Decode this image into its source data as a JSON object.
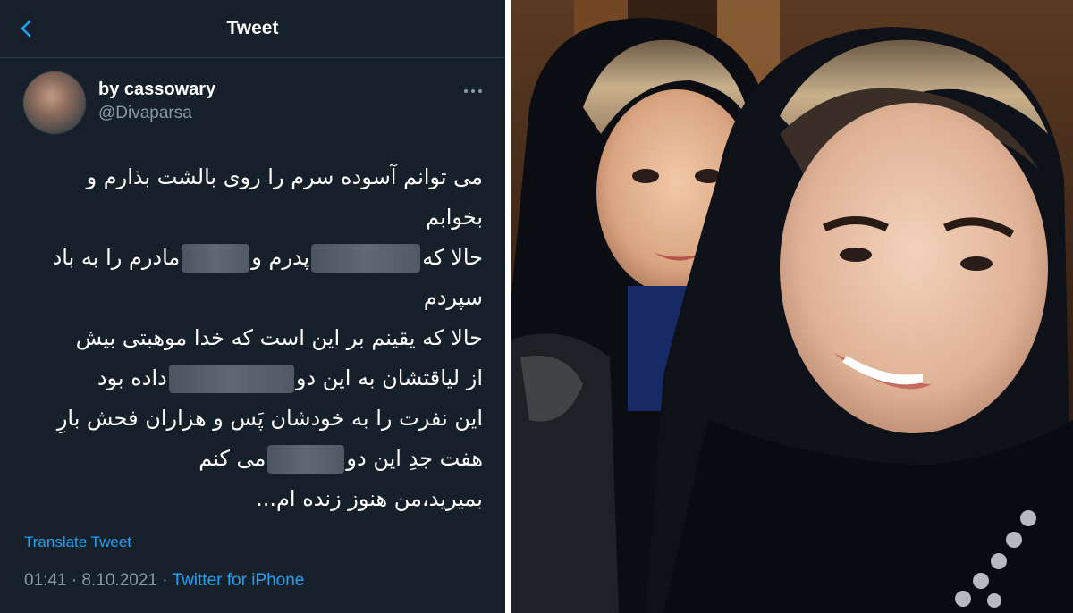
{
  "header": {
    "title": "Tweet",
    "back_icon": "chevron-left-icon"
  },
  "author": {
    "display_name": "by cassowary",
    "handle": "@Divaparsa"
  },
  "tweet": {
    "lines": {
      "l1": "می توانم آسوده سرم را روی بالشت بذارم و",
      "l2": "بخوابم",
      "l3a": "حالا که",
      "l3b": "پدرم و",
      "l3c": "مادرم را به باد",
      "l4": "سپردم",
      "l5": "حالا که یقینم بر این است که خدا موهبتی بیش",
      "l6a": "از لیاقتشان به این دو",
      "l6b": "داده بود",
      "l7": "این نفرت را به خودشان پَس و هزاران فحش بارِ",
      "l8a": "هفت جدِ این دو",
      "l8b": "می کنم",
      "l9": "بمیرید،من هنوز زنده ام..."
    }
  },
  "translate_label": "Translate Tweet",
  "meta": {
    "timestamp": "01:41 · 8.10.2021 ·",
    "source": "Twitter for iPhone"
  },
  "colors": {
    "background": "#15202b",
    "link": "#1da1f2",
    "secondary_text": "#8899a6"
  }
}
